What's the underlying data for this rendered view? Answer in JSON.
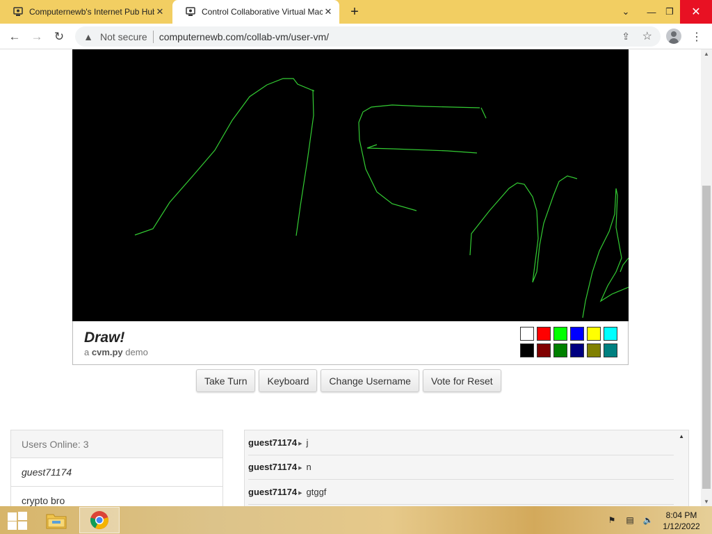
{
  "browser": {
    "tabs": [
      {
        "title": "Computernewb's Internet Pub Hub",
        "active": false
      },
      {
        "title": "Control Collaborative Virtual Machine",
        "active": true
      }
    ],
    "new_tab_icon": "plus-icon",
    "security_label": "Not secure",
    "url": "computernewb.com/collab-vm/user-vm/"
  },
  "vm": {
    "drawing_color": "#33cc33",
    "panel_title": "Draw!",
    "panel_sub_prefix": "a",
    "panel_sub_name": "cvm.py",
    "panel_sub_suffix": "demo",
    "palette": [
      "#ffffff",
      "#ff0000",
      "#00ff00",
      "#0000ff",
      "#ffff00",
      "#00ffff",
      "#000000",
      "#800000",
      "#008000",
      "#000080",
      "#808000",
      "#008080"
    ]
  },
  "buttons": {
    "take_turn": "Take Turn",
    "keyboard": "Keyboard",
    "change_username": "Change Username",
    "vote_reset": "Vote for Reset"
  },
  "users": {
    "header": "Users Online: 3",
    "list": [
      "guest71174",
      "crypto bro"
    ]
  },
  "chat": {
    "messages": [
      {
        "user": "guest71174",
        "text": "j"
      },
      {
        "user": "guest71174",
        "text": "n"
      },
      {
        "user": "guest71174",
        "text": "gtggf"
      }
    ]
  },
  "taskbar": {
    "time": "8:04 PM",
    "date": "1/12/2022"
  }
}
